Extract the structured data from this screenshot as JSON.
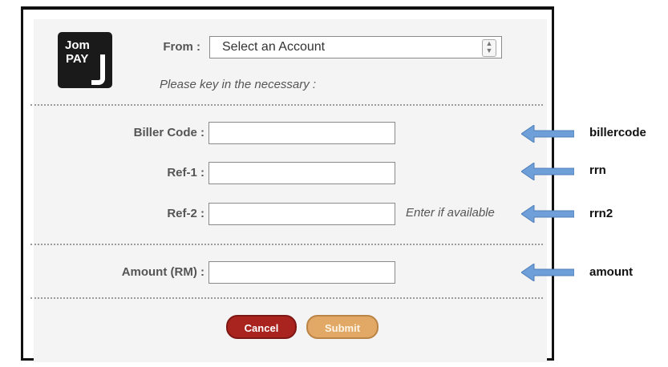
{
  "logo": {
    "line1": "Jom",
    "line2": "PAY"
  },
  "from": {
    "label": "From :",
    "selected": "Select an Account"
  },
  "instruction": "Please key in the necessary :",
  "fields": [
    {
      "label": "Biller Code :",
      "value": "",
      "annotation": "billercode"
    },
    {
      "label": "Ref-1 :",
      "value": "",
      "annotation": "rrn"
    },
    {
      "label": "Ref-2 :",
      "value": "",
      "hint": "Enter if available",
      "annotation": "rrn2"
    },
    {
      "label": "Amount (RM) :",
      "value": "",
      "annotation": "amount"
    }
  ],
  "buttons": {
    "cancel": "Cancel",
    "submit": "Submit"
  },
  "colors": {
    "arrow": "#6f9fd8",
    "cancel": "#a9231f",
    "submit": "#e2a865"
  }
}
